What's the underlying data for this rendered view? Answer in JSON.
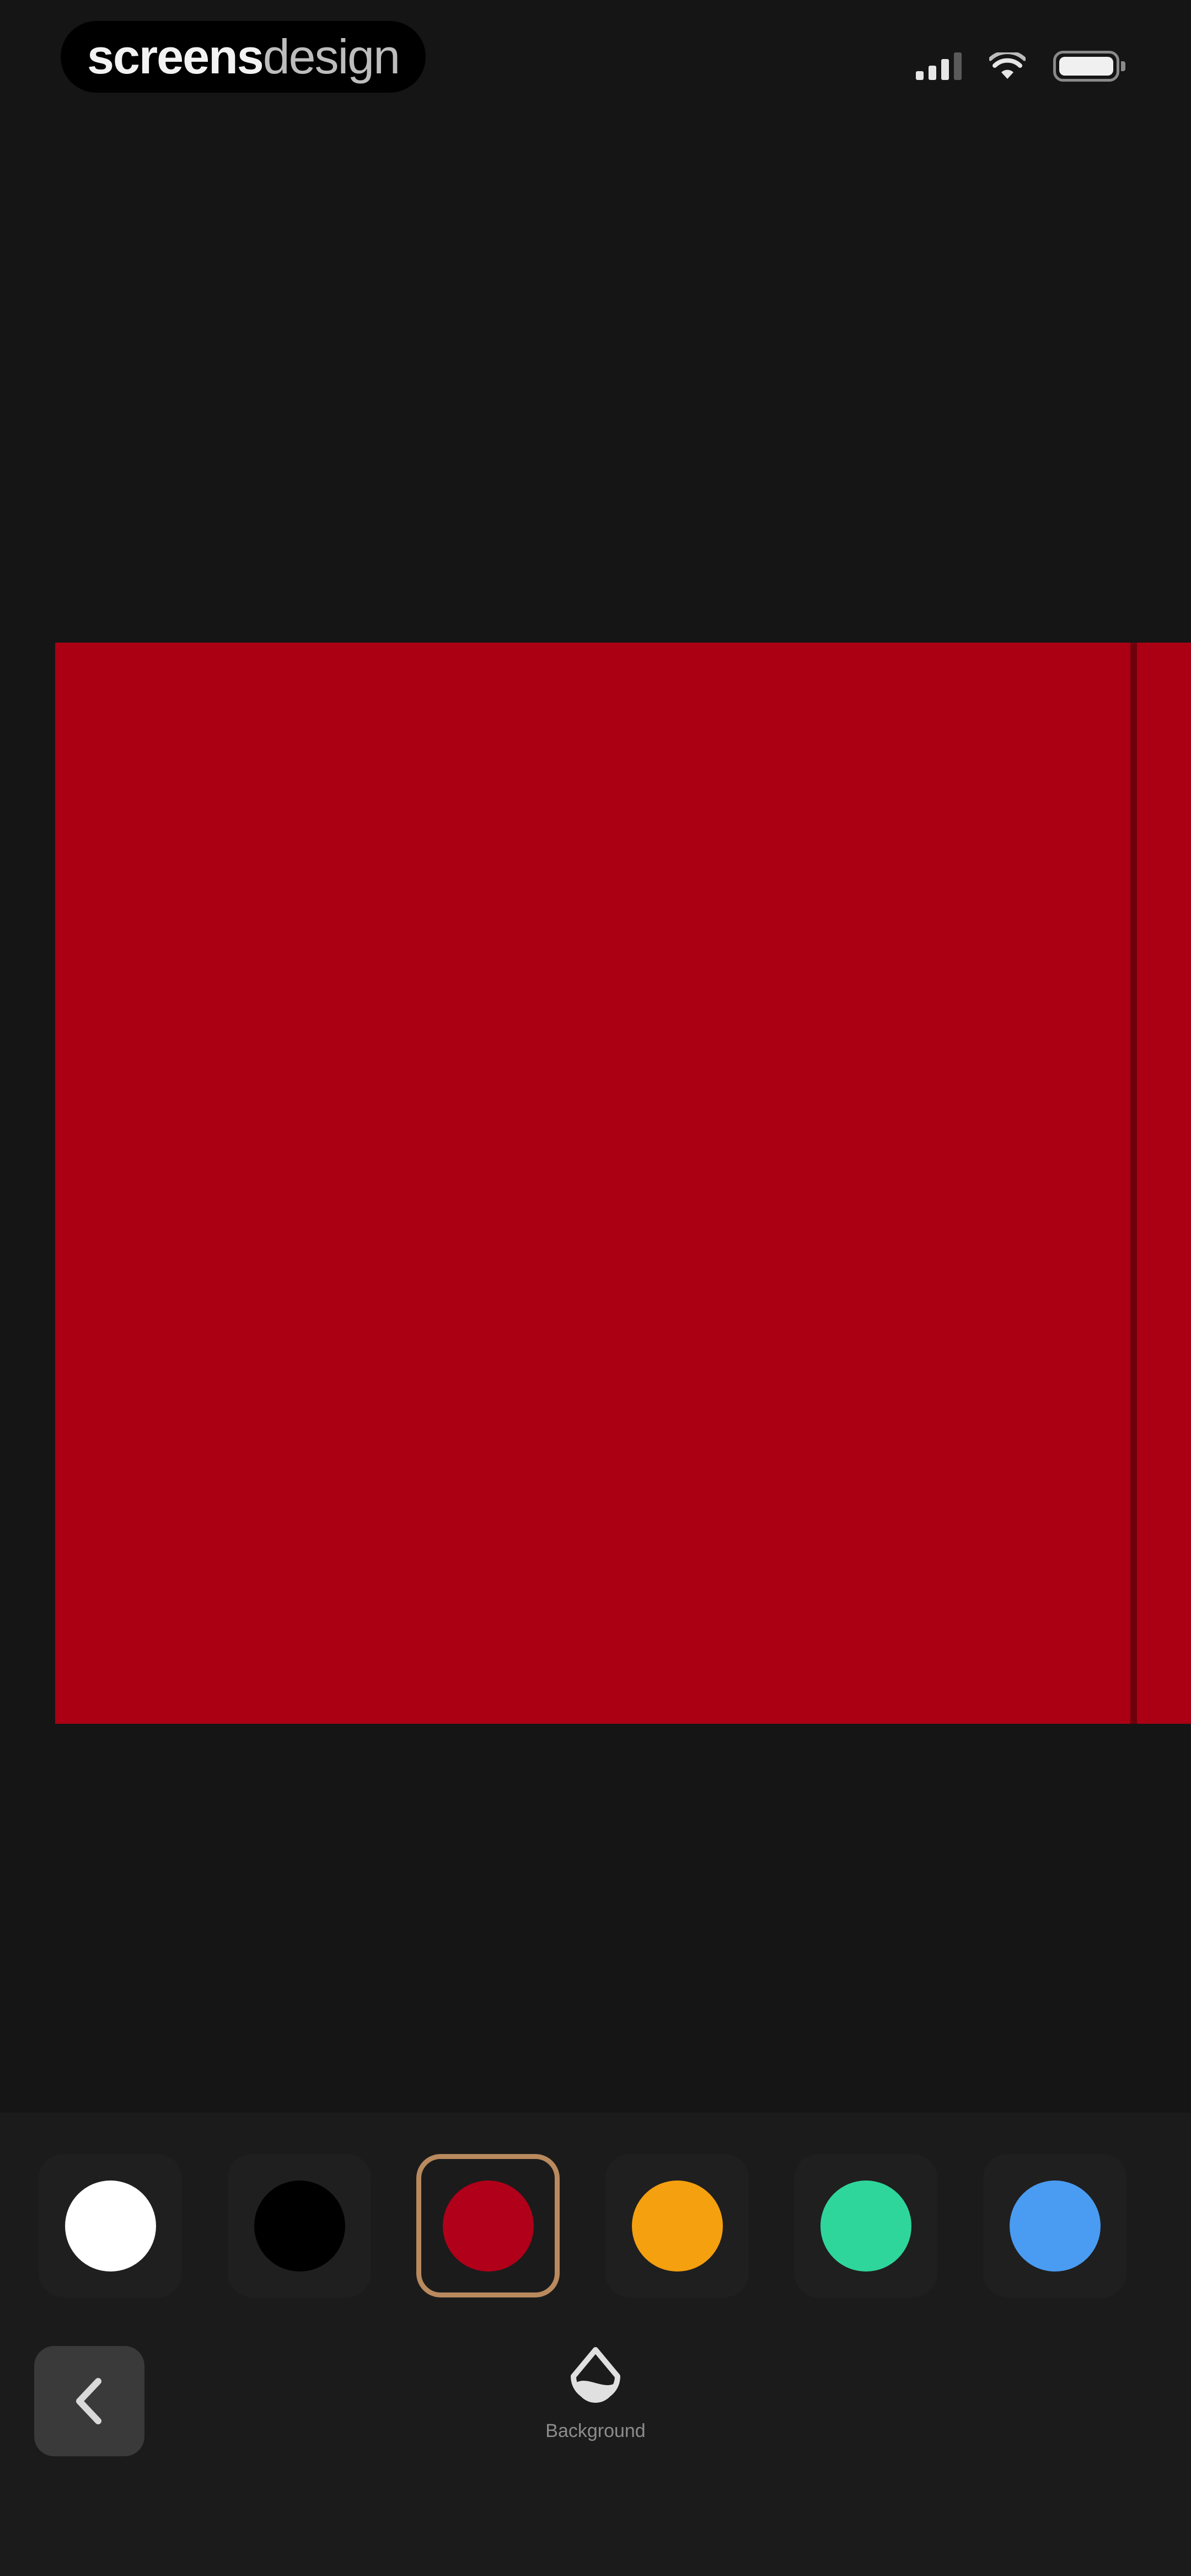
{
  "watermark": {
    "bold": "screens",
    "light": "design"
  },
  "status": {
    "icons": [
      "signal-icon",
      "wifi-icon",
      "battery-icon"
    ]
  },
  "canvas": {
    "color": "#ab0014"
  },
  "swatches": [
    {
      "name": "white",
      "color": "#ffffff",
      "selected": false
    },
    {
      "name": "black",
      "color": "#000000",
      "selected": false
    },
    {
      "name": "red",
      "color": "#b0001a",
      "selected": true
    },
    {
      "name": "orange",
      "color": "#f5a00f",
      "selected": false
    },
    {
      "name": "green",
      "color": "#2fd69c",
      "selected": false
    },
    {
      "name": "blue",
      "color": "#4a9cf2",
      "selected": false
    }
  ],
  "toolbar": {
    "back_icon": "chevron-left-icon",
    "tool_icon": "background-icon",
    "tool_label": "Background"
  }
}
